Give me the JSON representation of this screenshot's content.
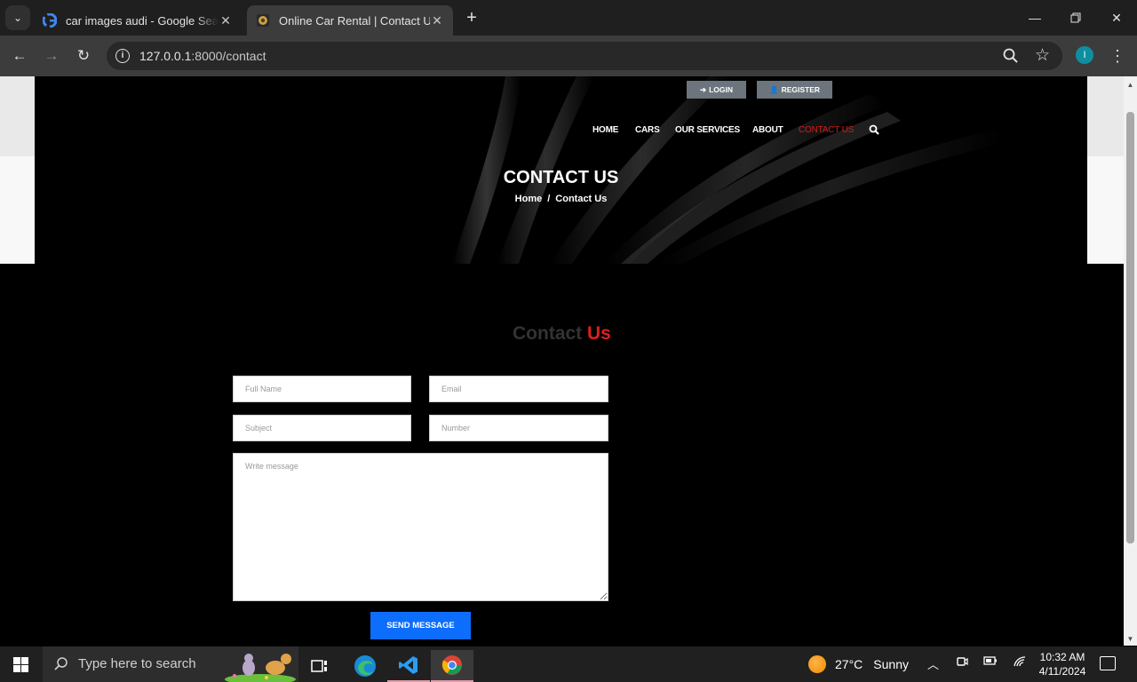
{
  "browser": {
    "tabs": [
      {
        "title": "car images audi - Google Search",
        "active": false
      },
      {
        "title": "Online Car Rental | Contact Us",
        "active": true
      }
    ],
    "url_host": "127.0.0.1",
    "url_path": ":8000/contact"
  },
  "header": {
    "login_label": "LOGIN",
    "register_label": "REGISTER",
    "nav": [
      "HOME",
      "CARS",
      "OUR SERVICES",
      "ABOUT",
      "CONTACT US"
    ],
    "active_nav": "CONTACT US",
    "hero_title": "CONTACT US",
    "breadcrumb": {
      "home": "Home",
      "sep": "/",
      "current": "Contact Us"
    }
  },
  "contact": {
    "title_a": "Contact",
    "title_b": "Us",
    "placeholders": {
      "full_name": "Full Name",
      "email": "Email",
      "subject": "Subject",
      "number": "Number",
      "message": "Write message"
    },
    "send_label": "SEND MESSAGE"
  },
  "taskbar": {
    "search_placeholder": "Type here to search",
    "weather_temp": "27°C",
    "weather_cond": "Sunny",
    "time": "10:32 AM",
    "date": "4/11/2024"
  },
  "colors": {
    "accent_red": "#e01e1e",
    "button_blue": "#0d6efd",
    "top_button_gray": "#6c757d"
  }
}
